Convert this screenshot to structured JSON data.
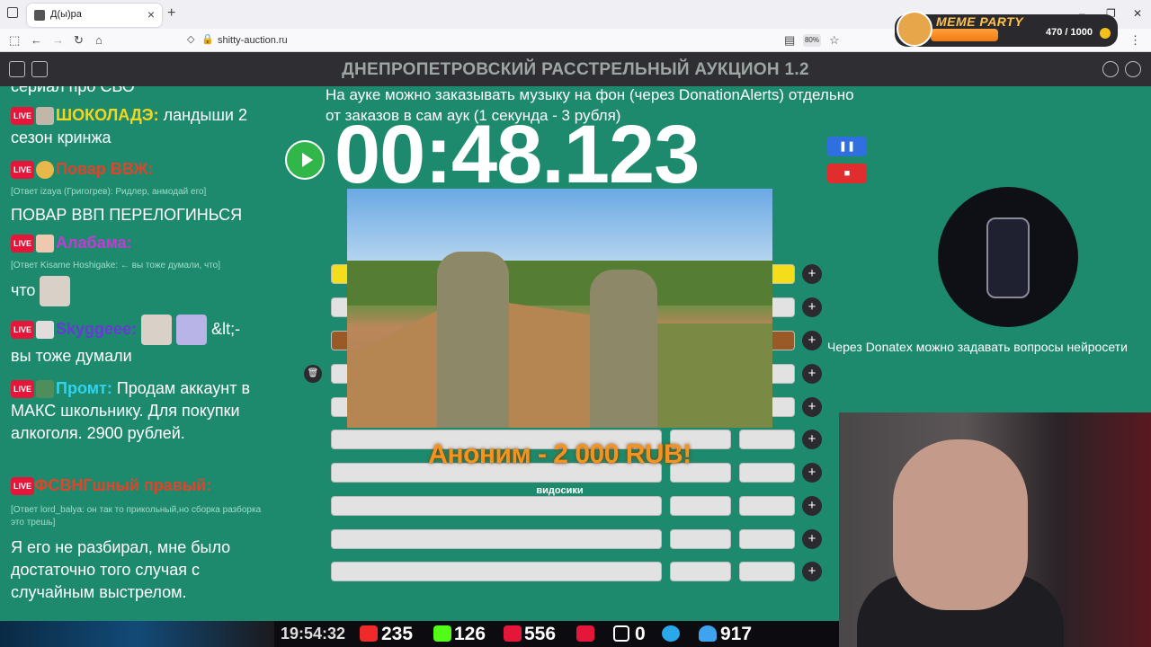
{
  "browser": {
    "tab_title": "Д(ы)ра",
    "url": "shitty-auction.ru",
    "zoom": "80%",
    "new_tab": "+"
  },
  "meme_party": {
    "title": "MEME PARTY",
    "counter": "470 / 1000"
  },
  "app": {
    "title": "ДНЕПРОПЕТРОВСКИЙ РАССТРЕЛЬНЫЙ АУКЦИОН 1.2"
  },
  "chat": {
    "top_fragment": "сериал про СВО",
    "live_label": "LIVE",
    "messages": [
      {
        "author": "ШОКОЛАДЭ:",
        "author_color": "#f7d51d",
        "text": " ландыши 2 сезон кринжа"
      },
      {
        "author": "Повар ВВЖ:",
        "author_color": "#e0442a",
        "reply": "[Ответ izaya (Григогрев): Ридлер, анмодай его]",
        "text": "ПОВАР ВВП ПЕРЕЛОГИНЬСЯ"
      },
      {
        "author": "Алабама:",
        "author_color": "#c23bd6",
        "reply": "[Ответ Kisame Hoshigake: ← вы тоже думали, что]",
        "text": "что"
      },
      {
        "author": "Skyggeee:",
        "author_color": "#6b38d9",
        "text": " &lt;-",
        "text2": "вы тоже думали"
      },
      {
        "author": "Промт:",
        "author_color": "#2fd3ee",
        "text": " Продам аккаунт в МАКС школьнику. Для покупки алкоголя. 2900 рублей."
      },
      {
        "author": "ФСВНГшный правый:",
        "author_color": "#e0442a",
        "reply": "[Ответ lord_balya: он так то прикольный,но сборка разборка это трешь]",
        "text": "Я его не разбирал, мне было достаточно того случая с случайным выстрелом."
      }
    ]
  },
  "auction": {
    "info": "На ауке можно заказывать музыку на фон (через DonationAlerts) отдельно от заказов в сам аук (1 секунда - 3 рубля)",
    "timer": "00:48.123",
    "plus": "+",
    "pause": "❚❚",
    "stop": "■"
  },
  "donation": {
    "text": "Аноним - 2 000 RUB!",
    "label": "видосики"
  },
  "side": {
    "question": "Через Donatex можно задавать вопросы нейросети"
  },
  "stats": {
    "time": "19:54:32",
    "youtube": "235",
    "kick": "126",
    "live": "556",
    "rutube": "0",
    "telegram": "",
    "viewers": "917"
  },
  "colors": {
    "background": "#1d8a6e",
    "header": "#2e2e33",
    "play": "#31b64a",
    "pause": "#2f6fe0",
    "stop": "#e02d2d",
    "donation": "#f4931f"
  }
}
